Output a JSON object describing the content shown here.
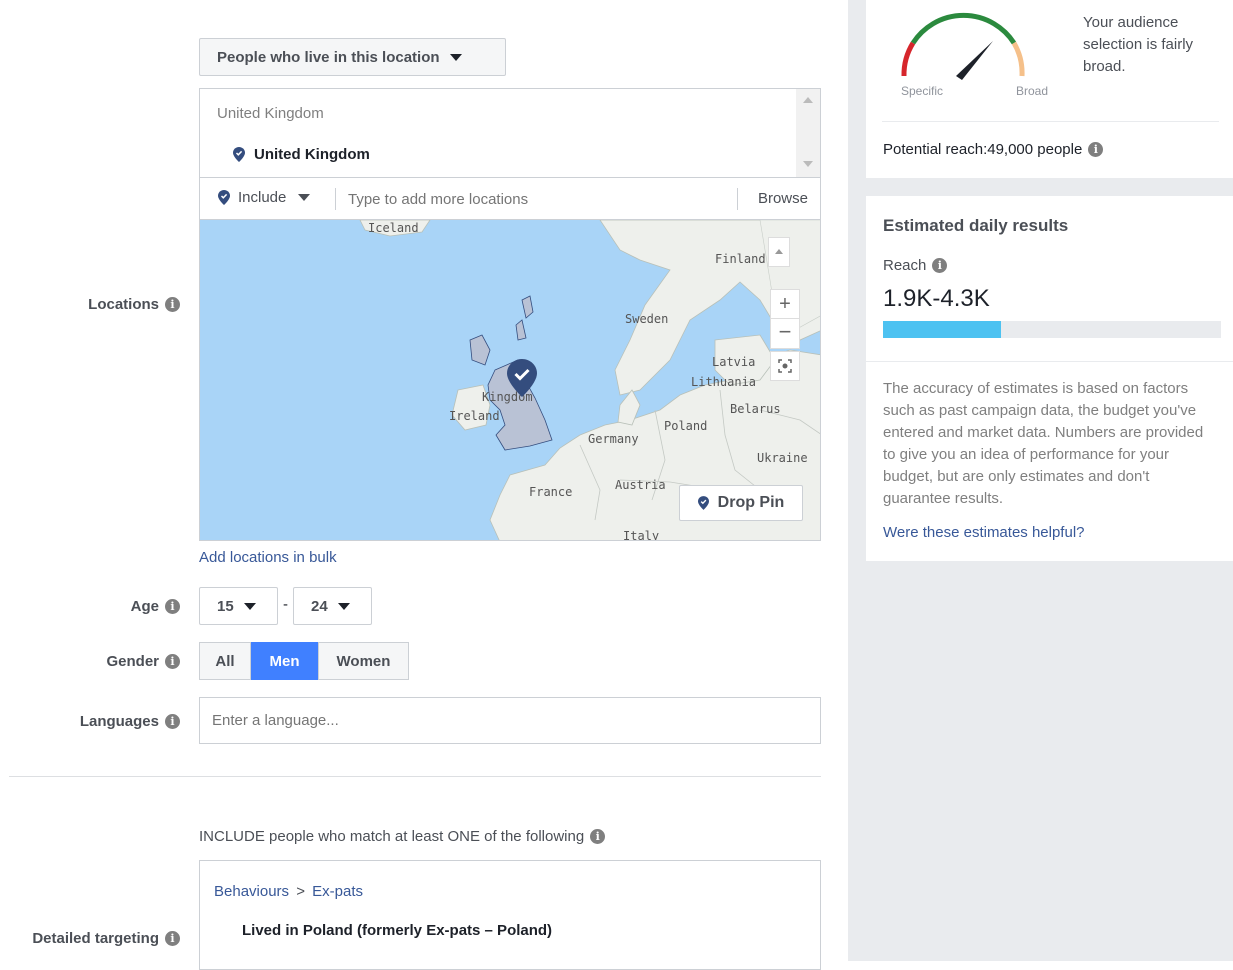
{
  "locations": {
    "label": "Locations",
    "type_button": "People who live in this location",
    "group_header": "United Kingdom",
    "selected": "United Kingdom",
    "include_label": "Include",
    "search_placeholder": "Type to add more locations",
    "browse": "Browse",
    "add_bulk": "Add locations in bulk",
    "drop_pin": "Drop Pin",
    "map_labels": {
      "iceland": "Iceland",
      "finland": "Finland",
      "sweden": "Sweden",
      "latvia": "Latvia",
      "lithuania": "Lithuania",
      "belarus": "Belarus",
      "poland": "Poland",
      "germany": "Germany",
      "ukraine": "Ukraine",
      "france": "France",
      "austria": "Austria",
      "italy": "Italy",
      "ireland": "Ireland",
      "kingdom": "Kingdom"
    }
  },
  "age": {
    "label": "Age",
    "min": "15",
    "max": "24",
    "separator": "-"
  },
  "gender": {
    "label": "Gender",
    "options": [
      "All",
      "Men",
      "Women"
    ],
    "selected": "Men"
  },
  "languages": {
    "label": "Languages",
    "placeholder": "Enter a language..."
  },
  "detailed_targeting": {
    "label": "Detailed targeting",
    "include_text": "INCLUDE people who match at least ONE of the following",
    "breadcrumb_root": "Behaviours",
    "breadcrumb_sep": ">",
    "breadcrumb_leaf": "Ex-pats",
    "item": "Lived in Poland (formerly Ex-pats – Poland)"
  },
  "audience": {
    "meter_specific": "Specific",
    "meter_broad": "Broad",
    "description": "Your audience selection is fairly broad.",
    "potential_reach": "Potential reach:49,000 people"
  },
  "estimates": {
    "title": "Estimated daily results",
    "reach_label": "Reach",
    "reach_value": "1.9K-4.3K",
    "reach_bar_fraction": 0.35,
    "disclaimer": "The accuracy of estimates is based on factors such as past campaign data, the budget you've entered and market data. Numbers are provided to give you an idea of performance for your budget, but are only estimates and don't guarantee results.",
    "feedback_link": "Were these estimates helpful?"
  },
  "colors": {
    "accent": "#4080ff",
    "link": "#385898",
    "bar": "#4dc2f1",
    "panel": "#e9ebee",
    "pin": "#344d7e"
  }
}
